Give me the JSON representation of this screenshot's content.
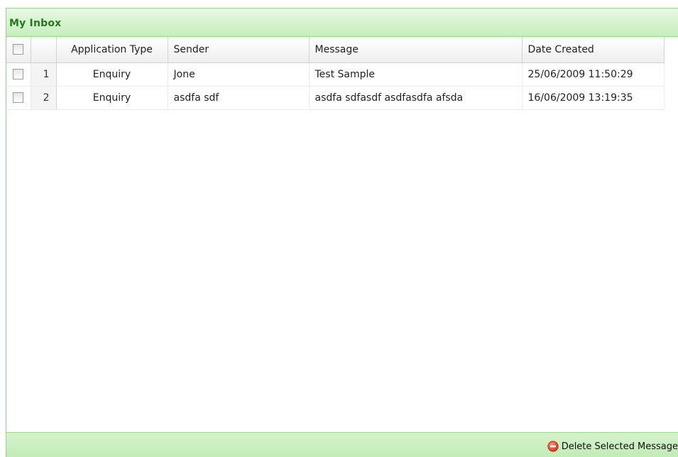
{
  "panel": {
    "title": "My Inbox"
  },
  "grid": {
    "columns": [
      {
        "key": "select",
        "label": ""
      },
      {
        "key": "num",
        "label": ""
      },
      {
        "key": "type",
        "label": "Application Type"
      },
      {
        "key": "sender",
        "label": "Sender"
      },
      {
        "key": "message",
        "label": "Message"
      },
      {
        "key": "date",
        "label": "Date Created"
      }
    ],
    "rows": [
      {
        "num": "1",
        "type": "Enquiry",
        "sender": "Jone",
        "message": "Test Sample",
        "date": "25/06/2009 11:50:29",
        "checked": false
      },
      {
        "num": "2",
        "type": "Enquiry",
        "sender": "asdfa sdf",
        "message": "asdfa sdfasdf asdfasdfa afsda",
        "date": "16/06/2009 13:19:35",
        "checked": false
      }
    ]
  },
  "footer": {
    "delete_label": "Delete Selected Message",
    "delete_icon": "delete-minus-circle-icon",
    "delete_icon_color": "#e0452a"
  },
  "colors": {
    "header_title": "#227a1e",
    "header_bg": "#c6eebd",
    "border": "#99cc99"
  }
}
